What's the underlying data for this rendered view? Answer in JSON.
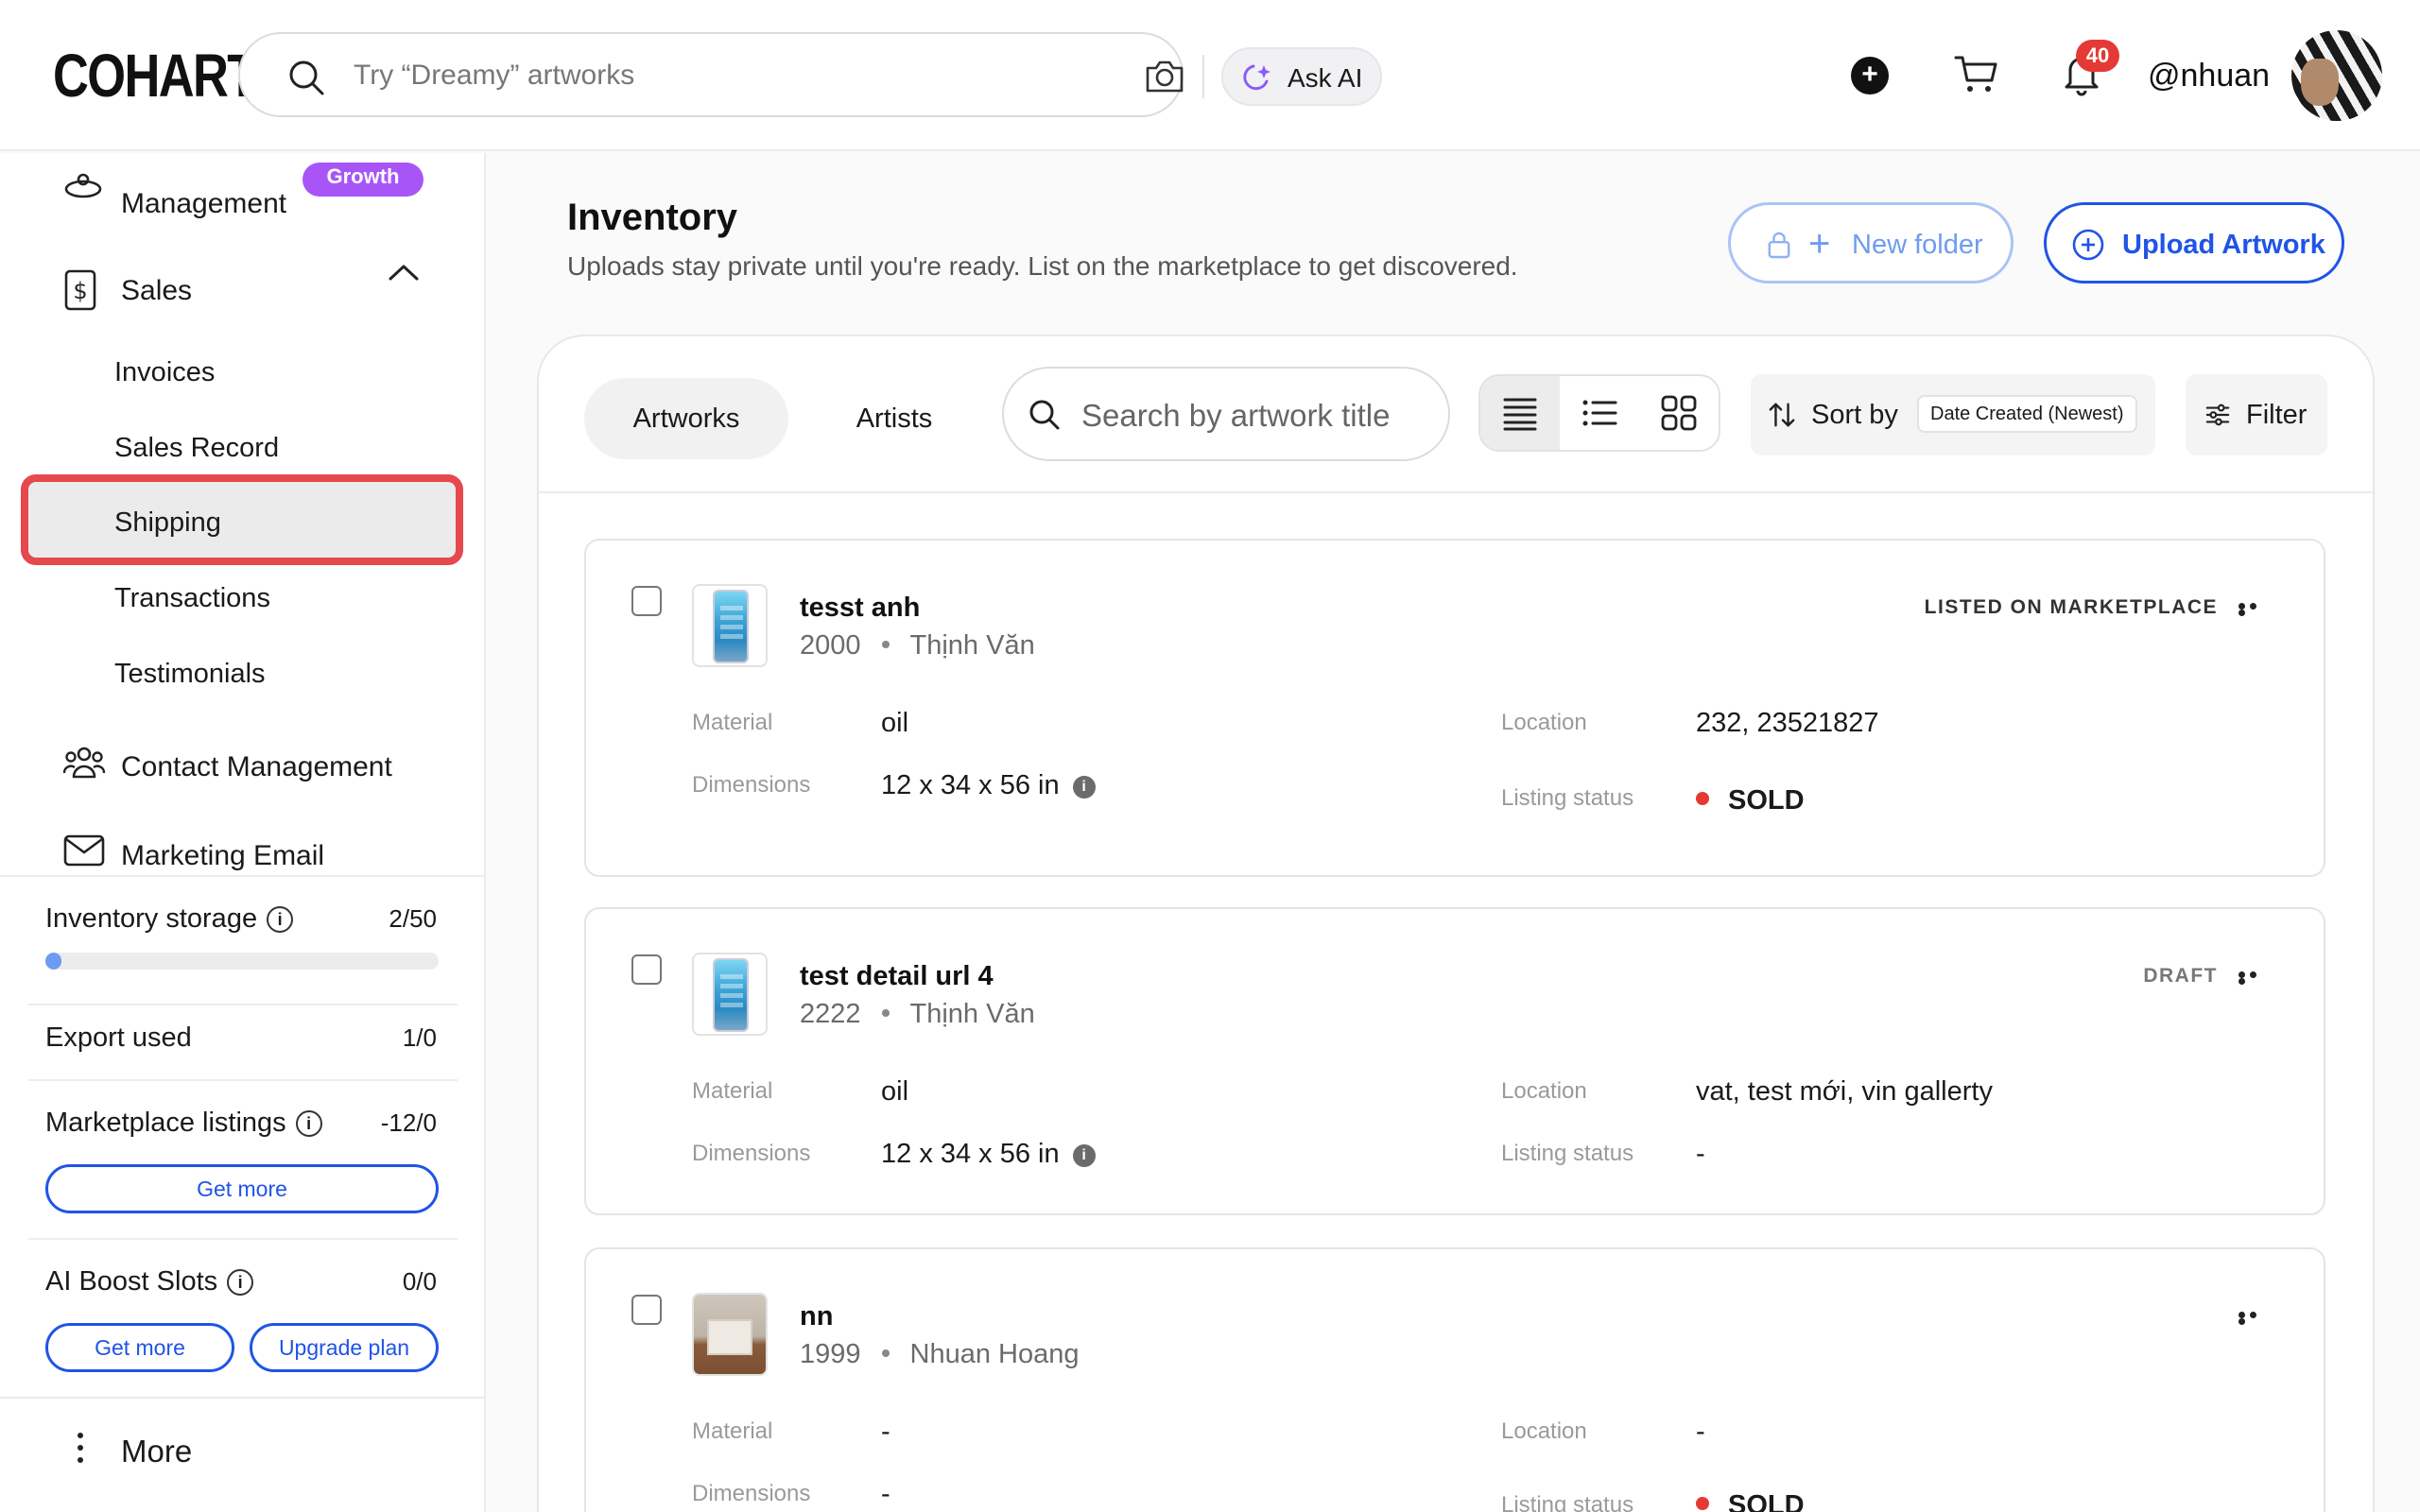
{
  "header": {
    "logo": "COHART",
    "search_placeholder": "Try “Dreamy” artworks",
    "ask_ai_label": "Ask AI",
    "notification_count": "40",
    "username": "@nhuan"
  },
  "sidebar": {
    "management_label": "Management",
    "growth_badge": "Growth",
    "sales_label": "Sales",
    "sales_items": [
      "Invoices",
      "Sales Record",
      "Shipping",
      "Transactions",
      "Testimonials"
    ],
    "contact_label": "Contact Management",
    "marketing_label": "Marketing Email",
    "inventory_storage": {
      "label": "Inventory storage",
      "value": "2/50",
      "fraction": 0.04
    },
    "export_used": {
      "label": "Export used",
      "value": "1/0"
    },
    "marketplace_listings": {
      "label": "Marketplace listings",
      "value": "-12/0",
      "button": "Get more"
    },
    "ai_boost": {
      "label": "AI Boost Slots",
      "value": "0/0",
      "button_get": "Get more",
      "button_upgrade": "Upgrade plan"
    },
    "more_label": "More"
  },
  "main": {
    "title": "Inventory",
    "subtitle": "Uploads stay private until you're ready. List on the marketplace to get discovered.",
    "new_folder_label": "New folder",
    "upload_label": "Upload Artwork",
    "tabs": [
      "Artworks",
      "Artists"
    ],
    "search_placeholder": "Search by artwork title",
    "sort_label": "Sort by",
    "sort_value": "Date Created (Newest)",
    "filter_label": "Filter",
    "field_labels": {
      "material": "Material",
      "dimensions": "Dimensions",
      "location": "Location",
      "listing_status": "Listing status"
    },
    "artworks": [
      {
        "title": "tesst anh",
        "year": "2000",
        "artist": "Thịnh Văn",
        "status": "LISTED ON MARKETPLACE",
        "material": "oil",
        "dimensions": "12 x 34 x 56 in",
        "location": "232, 23521827",
        "listing_status": "SOLD"
      },
      {
        "title": "test detail url 4",
        "year": "2222",
        "artist": "Thịnh Văn",
        "status": "DRAFT",
        "material": "oil",
        "dimensions": "12 x 34 x 56 in",
        "location": "vat, test mới, vin gallerty",
        "listing_status": "-"
      },
      {
        "title": "nn",
        "year": "1999",
        "artist": "Nhuan Hoang",
        "status": "",
        "material": "-",
        "dimensions": "-",
        "location": "-",
        "listing_status": "SOLD"
      }
    ]
  },
  "colors": {
    "accent": "#1f54e6",
    "highlight": "#e5484d",
    "sold": "#e53935",
    "growth": "#a855f7"
  }
}
